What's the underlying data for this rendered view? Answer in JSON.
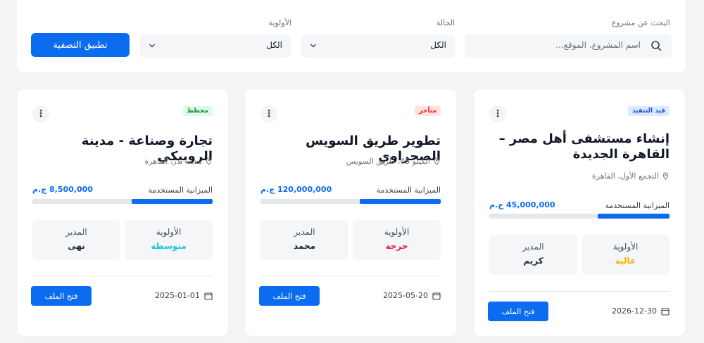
{
  "filters": {
    "search": {
      "label": "البحث عن مشروع",
      "placeholder": "اسم المشروع، الموقع..."
    },
    "status": {
      "label": "الحالة",
      "value": "الكل"
    },
    "priority": {
      "label": "الأولوية",
      "value": "الكل"
    },
    "apply_label": "تطبيق التصفية"
  },
  "labels": {
    "budget_used": "الميزانية المستخدمة",
    "priority": "الأولوية",
    "manager": "المدير",
    "open_file": "فتح الملف"
  },
  "colors": {
    "accent": "#0b6cf0",
    "priority_high": "#f5b301",
    "priority_critical": "#e11d48",
    "priority_medium": "#22c7d9"
  },
  "projects": [
    {
      "status": "قيد التنفيذ",
      "title": "إنشاء مستشفى أهل مصر – القاهرة الجديدة",
      "location": "التجمع الأول، القاهرة",
      "budget": "45,000,000 ج.م",
      "budget_used_fraction": 0.4,
      "priority": "عالية",
      "manager": "كريم",
      "date": "2026-12-30"
    },
    {
      "status": "متأخر",
      "title": "تطوير طريق السويس الصحراوي",
      "location": "الكيلو 45، طريق السويس",
      "budget": "120,000,000 ج.م",
      "budget_used_fraction": 0.45,
      "priority": "حرجة",
      "manager": "محمد",
      "date": "2025-05-20"
    },
    {
      "status": "مخطط",
      "title": "تجارة وصناعة - مدينة الروبيكي",
      "location": "مدينة بدر، القاهرة",
      "budget": "8,500,000 ج.م",
      "budget_used_fraction": 0.45,
      "priority": "متوسطة",
      "manager": "نهى",
      "date": "2025-01-01"
    }
  ]
}
